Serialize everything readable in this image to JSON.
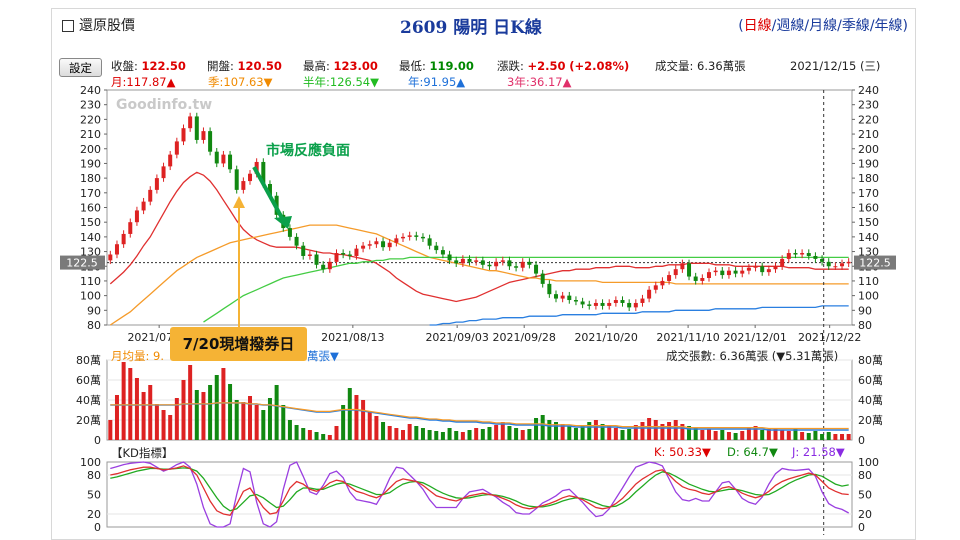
{
  "header": {
    "checkbox_label": "還原股價",
    "title": "2609 陽明 日K線",
    "periods_open": "(",
    "periods": [
      "日線",
      "週線",
      "月線",
      "季線",
      "年線"
    ],
    "periods_close": ")",
    "selected_period": "日線"
  },
  "quote": {
    "settings_label": "設定",
    "close_label": "收盤:",
    "close": "122.50",
    "open_label": "開盤:",
    "open": "120.50",
    "high_label": "最高:",
    "high": "123.00",
    "low_label": "最低:",
    "low": "119.00",
    "change_label": "漲跌:",
    "change": "+2.50",
    "change_pct": "(+2.08%)",
    "volume_label": "成交量:",
    "volume": "6.36萬張",
    "date": "2021/12/15 (三)"
  },
  "moving_averages": [
    {
      "label": "月:117.87▲",
      "color": "#dd0000"
    },
    {
      "label": "季:107.63▼",
      "color": "#f08a00"
    },
    {
      "label": "半年:126.54▼",
      "color": "#22bb22"
    },
    {
      "label": "年:91.95▲",
      "color": "#1e70d8"
    },
    {
      "label": "3年:36.17▲",
      "color": "#e0306a"
    }
  ],
  "watermark": "Goodinfo.tw",
  "annotations": {
    "event": "7/20現增撥券日",
    "market": "市場反應負面"
  },
  "volume_panel": {
    "left_label": "月均量: 9.",
    "left_label_tail": "萬張▼",
    "right_label": "成交張數: 6.36萬張 (▼5.31萬張)",
    "unit": "萬"
  },
  "kd_panel": {
    "title": "【KD指標】",
    "k_label": "K: 50.33▼",
    "d_label": "D: 64.7▼",
    "j_label": "J: 21.58▼"
  },
  "colors": {
    "up": "#dd2222",
    "down": "#118811",
    "accent": "#f5b335"
  },
  "chart_data": {
    "type": "candlestick",
    "price_axis": {
      "min": 80,
      "max": 240,
      "ticks": [
        80,
        90,
        100,
        110,
        120,
        130,
        140,
        150,
        160,
        170,
        180,
        190,
        200,
        210,
        220,
        230,
        240
      ],
      "current": "122.5"
    },
    "x_tick_labels": [
      "2021/07/20",
      "2021/08/13",
      "2021/09/03",
      "2021/09/28",
      "2021/10/20",
      "2021/11/10",
      "2021/12/01",
      "2021/12/22"
    ],
    "closes": [
      128,
      135,
      142,
      150,
      158,
      164,
      172,
      180,
      188,
      196,
      205,
      214,
      222,
      206,
      212,
      198,
      190,
      196,
      186,
      172,
      178,
      183,
      191,
      176,
      168,
      155,
      146,
      140,
      134,
      127,
      128,
      121,
      118,
      123,
      129,
      128,
      127,
      132,
      134,
      135,
      137,
      133,
      136,
      139,
      140,
      141,
      140,
      139,
      134,
      131,
      128,
      124,
      122,
      125,
      123,
      124,
      121,
      120,
      123,
      124,
      120,
      119,
      123,
      121,
      115,
      108,
      101,
      98,
      100,
      97,
      96,
      94,
      93,
      95,
      93,
      95,
      97,
      95,
      92,
      95,
      98,
      104,
      107,
      110,
      114,
      118,
      122,
      113,
      110,
      112,
      116,
      117,
      114,
      117,
      115,
      117,
      119,
      120,
      116,
      118,
      120,
      125,
      129,
      128,
      129,
      127,
      125,
      123,
      120,
      120,
      122,
      123
    ],
    "series": [
      {
        "name": "月",
        "values": [
          108,
          112,
          116,
          121,
          127,
          134,
          140,
          148,
          156,
          164,
          171,
          177,
          181,
          184,
          182,
          178,
          172,
          165,
          158,
          151,
          145,
          141,
          138,
          136,
          134,
          133,
          133,
          133,
          133,
          132,
          131,
          130,
          129,
          129,
          128,
          128,
          127,
          126,
          125,
          124,
          122,
          119,
          116,
          112,
          109,
          106,
          103,
          101,
          100,
          99,
          98,
          97,
          96,
          97,
          98,
          99,
          101,
          103,
          105,
          107,
          109,
          110,
          111,
          112,
          113,
          114,
          115,
          116,
          117,
          117,
          118,
          118,
          118,
          119,
          119,
          119,
          120,
          120,
          120,
          119,
          119,
          119,
          120,
          120,
          121,
          121,
          121,
          122,
          122,
          122,
          122,
          121,
          121,
          121,
          120,
          120,
          120,
          120,
          120,
          120,
          120,
          120,
          119,
          119,
          119,
          119,
          118,
          118,
          118,
          118,
          118,
          118
        ]
      },
      {
        "name": "季",
        "values": [
          80,
          83,
          86,
          89,
          93,
          97,
          101,
          105,
          109,
          113,
          117,
          120,
          123,
          126,
          128,
          130,
          132,
          134,
          136,
          137,
          138,
          139,
          140,
          141,
          142,
          143,
          144,
          145,
          146,
          147,
          148,
          148,
          148,
          148,
          148,
          147,
          146,
          145,
          144,
          143,
          142,
          140,
          138,
          136,
          134,
          132,
          130,
          128,
          126,
          125,
          124,
          123,
          122,
          121,
          120,
          119,
          118,
          117,
          117,
          116,
          115,
          114,
          113,
          112,
          112,
          111,
          111,
          110,
          110,
          110,
          110,
          110,
          110,
          110,
          109,
          109,
          109,
          109,
          109,
          109,
          109,
          109,
          109,
          109,
          109,
          108,
          108,
          108,
          108,
          108,
          108,
          108,
          108,
          108,
          108,
          108,
          108,
          108,
          108,
          108,
          108,
          108,
          108,
          108,
          108,
          108,
          108,
          108,
          108,
          108,
          108,
          108
        ]
      },
      {
        "name": "半年",
        "values": [
          40,
          43,
          46,
          49,
          52,
          55,
          58,
          61,
          64,
          67,
          70,
          73,
          76,
          79,
          82,
          85,
          88,
          91,
          94,
          97,
          100,
          102,
          104,
          106,
          108,
          110,
          112,
          113,
          114,
          115,
          116,
          117,
          118,
          119,
          120,
          121,
          122,
          122,
          123,
          123,
          124,
          124,
          125,
          125,
          125,
          126,
          126,
          126,
          126,
          126,
          126,
          126,
          126,
          126,
          126,
          126,
          126,
          126,
          126,
          126,
          126,
          126,
          126,
          126,
          126,
          126,
          126,
          126,
          126,
          126,
          126,
          126,
          126,
          126,
          126,
          126,
          126,
          126,
          126,
          126,
          126,
          126,
          126,
          126,
          126,
          126,
          126,
          126,
          126,
          126,
          126,
          126,
          126,
          126,
          126,
          126,
          126,
          126,
          126,
          126,
          126,
          126,
          126,
          126,
          126,
          126,
          126,
          126,
          126,
          126,
          126,
          126
        ]
      },
      {
        "name": "年",
        "values": [
          40,
          41,
          42,
          43,
          44,
          45,
          46,
          47,
          48,
          49,
          50,
          51,
          52,
          53,
          54,
          55,
          56,
          57,
          58,
          59,
          60,
          61,
          62,
          63,
          64,
          65,
          66,
          67,
          68,
          69,
          70,
          71,
          72,
          72,
          73,
          73,
          74,
          74,
          75,
          75,
          76,
          76,
          77,
          77,
          78,
          78,
          79,
          79,
          80,
          80,
          81,
          81,
          82,
          82,
          83,
          83,
          84,
          84,
          84,
          85,
          85,
          85,
          85,
          86,
          86,
          86,
          86,
          86,
          87,
          87,
          87,
          87,
          87,
          87,
          88,
          88,
          88,
          88,
          88,
          88,
          89,
          89,
          89,
          89,
          89,
          90,
          90,
          90,
          90,
          90,
          90,
          91,
          91,
          91,
          91,
          91,
          91,
          91,
          92,
          92,
          92,
          92,
          92,
          92,
          92,
          92,
          92,
          93,
          93,
          93,
          93,
          93
        ]
      }
    ],
    "volume_axis": {
      "ticks": [
        "0",
        "20萬",
        "40萬",
        "60萬",
        "80萬"
      ],
      "max": 80
    },
    "volume": [
      20,
      45,
      78,
      72,
      62,
      48,
      55,
      36,
      30,
      25,
      42,
      60,
      75,
      50,
      48,
      55,
      65,
      72,
      56,
      40,
      38,
      44,
      35,
      30,
      42,
      55,
      35,
      20,
      15,
      12,
      10,
      8,
      6,
      5,
      14,
      35,
      52,
      45,
      40,
      28,
      24,
      18,
      14,
      12,
      10,
      16,
      14,
      12,
      10,
      9,
      8,
      12,
      9,
      8,
      10,
      12,
      11,
      13,
      15,
      18,
      14,
      12,
      10,
      11,
      22,
      25,
      20,
      18,
      16,
      14,
      12,
      15,
      18,
      20,
      16,
      14,
      12,
      10,
      11,
      15,
      18,
      22,
      20,
      16,
      18,
      20,
      16,
      14,
      12,
      10,
      11,
      9,
      10,
      8,
      7,
      9,
      12,
      14,
      10,
      11,
      12,
      10,
      9,
      12,
      8,
      7,
      9,
      6,
      8,
      6,
      6,
      6
    ],
    "volume_ma": [
      35,
      35,
      35,
      35,
      35,
      35,
      35,
      35,
      35,
      35,
      35,
      36,
      36,
      36,
      36,
      36,
      37,
      37,
      37,
      37,
      37,
      36,
      36,
      35,
      35,
      34,
      33,
      32,
      31,
      30,
      29,
      28,
      28,
      28,
      29,
      30,
      30,
      30,
      29,
      28,
      27,
      26,
      25,
      24,
      23,
      22,
      22,
      21,
      20,
      20,
      19,
      19,
      18,
      18,
      18,
      18,
      17,
      17,
      16,
      16,
      16,
      15,
      15,
      15,
      15,
      15,
      14,
      14,
      14,
      14,
      13,
      13,
      13,
      13,
      13,
      13,
      13,
      12,
      12,
      12,
      12,
      12,
      12,
      12,
      12,
      12,
      12,
      11,
      11,
      11,
      11,
      11,
      11,
      11,
      11,
      11,
      11,
      11,
      11,
      10,
      10,
      10,
      10,
      10,
      10,
      10,
      10,
      10,
      10,
      10,
      10,
      10
    ],
    "kd_axis": {
      "ticks": [
        0,
        20,
        50,
        80,
        100
      ]
    },
    "kd": {
      "K": [
        80,
        82,
        85,
        88,
        90,
        92,
        92,
        90,
        88,
        89,
        91,
        94,
        90,
        80,
        60,
        40,
        25,
        20,
        18,
        35,
        55,
        60,
        45,
        30,
        20,
        22,
        40,
        60,
        70,
        66,
        58,
        55,
        60,
        68,
        72,
        70,
        62,
        55,
        52,
        48,
        45,
        50,
        60,
        70,
        74,
        72,
        70,
        64,
        56,
        48,
        45,
        42,
        40,
        44,
        48,
        50,
        52,
        50,
        48,
        44,
        40,
        34,
        30,
        28,
        30,
        33,
        36,
        40,
        45,
        48,
        46,
        42,
        36,
        30,
        28,
        30,
        36,
        44,
        55,
        66,
        74,
        80,
        86,
        88,
        80,
        70,
        62,
        58,
        56,
        52,
        50,
        54,
        60,
        62,
        58,
        52,
        48,
        45,
        48,
        55,
        64,
        70,
        74,
        77,
        80,
        83,
        80,
        70,
        60,
        55,
        51,
        50
      ],
      "D": [
        75,
        77,
        80,
        83,
        86,
        88,
        90,
        90,
        89,
        89,
        90,
        91,
        90,
        86,
        75,
        60,
        45,
        32,
        25,
        28,
        38,
        48,
        50,
        45,
        37,
        30,
        32,
        42,
        54,
        60,
        60,
        58,
        58,
        62,
        66,
        68,
        66,
        62,
        58,
        54,
        50,
        50,
        53,
        60,
        66,
        69,
        70,
        68,
        63,
        57,
        52,
        48,
        45,
        44,
        45,
        47,
        49,
        50,
        49,
        47,
        44,
        40,
        35,
        32,
        31,
        31,
        33,
        36,
        40,
        43,
        45,
        44,
        41,
        37,
        33,
        31,
        32,
        37,
        44,
        54,
        63,
        72,
        80,
        85,
        83,
        78,
        72,
        66,
        62,
        58,
        55,
        54,
        56,
        58,
        58,
        56,
        53,
        50,
        49,
        50,
        55,
        61,
        67,
        72,
        76,
        80,
        81,
        78,
        72,
        66,
        63,
        64.7
      ],
      "J": [
        90,
        93,
        96,
        98,
        99,
        100,
        98,
        92,
        86,
        90,
        96,
        100,
        92,
        66,
        30,
        5,
        0,
        0,
        5,
        50,
        90,
        85,
        38,
        5,
        0,
        8,
        58,
        95,
        100,
        78,
        54,
        50,
        64,
        82,
        86,
        76,
        54,
        42,
        40,
        38,
        35,
        52,
        75,
        92,
        90,
        80,
        70,
        58,
        42,
        30,
        30,
        30,
        30,
        44,
        54,
        56,
        58,
        52,
        46,
        38,
        32,
        22,
        20,
        20,
        28,
        37,
        42,
        48,
        56,
        58,
        48,
        38,
        26,
        16,
        18,
        28,
        44,
        60,
        77,
        92,
        96,
        100,
        98,
        94,
        74,
        54,
        42,
        40,
        44,
        40,
        40,
        54,
        68,
        70,
        58,
        44,
        38,
        35,
        46,
        66,
        82,
        90,
        88,
        87,
        88,
        89,
        78,
        54,
        36,
        30,
        27,
        21.58
      ]
    }
  }
}
